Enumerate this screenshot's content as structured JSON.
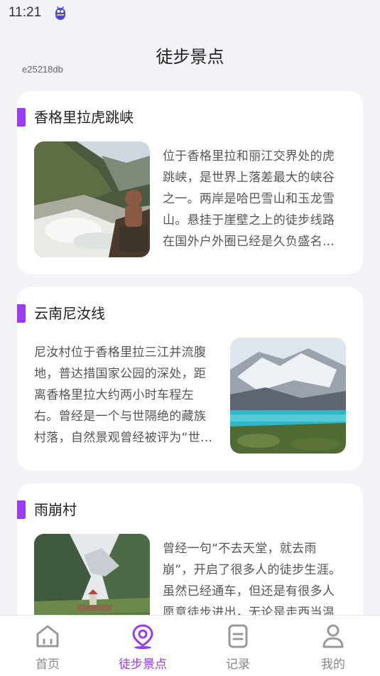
{
  "status_bar": {
    "time": "11:21",
    "app_icon": "android-app-icon"
  },
  "header": {
    "title": "徒步景点",
    "code": "e25218db"
  },
  "spots": [
    {
      "title": "香格里拉虎跳峡",
      "description": "位于香格里拉和丽江交界处的虎跳峡，是世界上落差最大的峡谷之一。两岸是哈巴雪山和玉龙雪山。悬挂于崖壁之上的徒步线路在国外户外圈已经是久负盛名…",
      "image": "tiger-leaping-gorge-photo"
    },
    {
      "title": "云南尼汝线",
      "description": "尼汝村位于香格里拉三江并流腹地，普达措国家公园的深处，距离香格里拉大约两小时车程左右。曾经是一个与世隔绝的藏族村落，自然景观曾经被评为“世…",
      "image": "snow-mountain-lake-photo"
    },
    {
      "title": "雨崩村",
      "description": "曾经一句“不去天堂，就去雨崩”，开启了很多人的徒步生涯。虽然已经通车，但还是有很多人愿意徒步进出，无论是走西当温泉…",
      "image": "yubeng-village-valley-photo"
    }
  ],
  "tabs": [
    {
      "label": "首页",
      "icon": "home-icon",
      "active": false
    },
    {
      "label": "徒步景点",
      "icon": "location-pin-icon",
      "active": true
    },
    {
      "label": "记录",
      "icon": "document-icon",
      "active": false
    },
    {
      "label": "我的",
      "icon": "user-icon",
      "active": false
    }
  ],
  "colors": {
    "accent": "#9b3cf3",
    "background": "#f3f2f6",
    "card": "#ffffff",
    "inactive": "#888888"
  }
}
